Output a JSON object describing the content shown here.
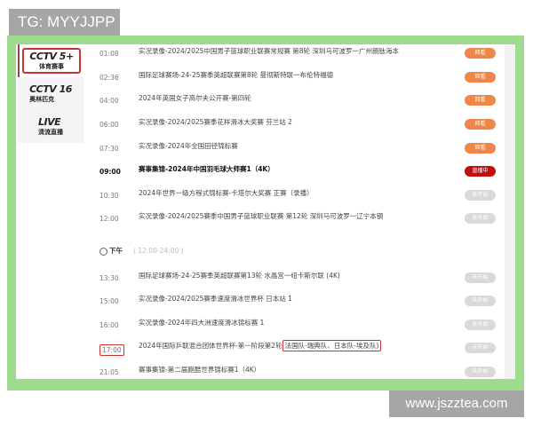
{
  "watermark_top": "TG: MYYJJPP",
  "watermark_bottom": "www.jszztea.com",
  "colors": {
    "frame": "#9fdb8f",
    "replay": "#f0874a",
    "live": "#c40d0d",
    "upcoming": "#d9d9d9",
    "highlight": "#c8342f"
  },
  "channels": [
    {
      "logo": "CCTV 5+",
      "sub": "体育赛事",
      "active": true
    },
    {
      "logo": "CCTV 16",
      "sub": "奥林匹克",
      "active": false
    },
    {
      "logo": "LIVE",
      "sub": "清流直播",
      "active": false
    }
  ],
  "period": {
    "icon": "clock-icon",
    "label": "下午",
    "range": "( 12:00-24:00 )"
  },
  "morning": [
    {
      "time": "01:08",
      "title": "实况录像-2024/2025中国男子篮球职业联赛常规赛 第8轮 深圳马可波罗一广州朗肽海本",
      "status": "回看",
      "type": "replay"
    },
    {
      "time": "02:36",
      "title": "国际足球赛场-24-25赛季英超联赛第8轮 曼彻斯特联一布伦特福德",
      "status": "回看",
      "type": "replay"
    },
    {
      "time": "04:00",
      "title": "2024年英国女子高尔夫公开赛-第四轮",
      "status": "回看",
      "type": "replay"
    },
    {
      "time": "06:00",
      "title": "实况录像-2024/2025赛季花样滑冰大奖赛 芬兰站 2",
      "status": "回看",
      "type": "replay"
    },
    {
      "time": "07:30",
      "title": "实况录像-2024年全国田径锦标赛",
      "status": "回看",
      "type": "replay"
    },
    {
      "time": "09:00",
      "title": "赛事集锦-2024年中国羽毛球大师赛1（4K）",
      "status": "直播中",
      "type": "live"
    },
    {
      "time": "10:30",
      "title": "2024年世界一级方程式锦标赛-卡塔尔大奖赛 正赛（录播）",
      "status": "未开始",
      "type": "upcoming"
    },
    {
      "time": "12:00",
      "title": "实况录像-2024/2025赛季中国男子篮球职业联赛 第12轮 深圳马可波罗一辽宁本钢",
      "status": "未开始",
      "type": "upcoming"
    }
  ],
  "afternoon": [
    {
      "time": "13:30",
      "title": "国际足球赛场-24-25赛季英超联赛第13轮 水晶宫一纽卡斯尔联 (4K)",
      "status": "未开始",
      "type": "upcoming"
    },
    {
      "time": "15:00",
      "title": "实况录像-2024/2025赛季速度滑冰世界杯 日本站 1",
      "status": "未开始",
      "type": "upcoming"
    },
    {
      "time": "16:00",
      "title": "实况录像-2024年四大洲速度滑冰锦标赛 1",
      "status": "未开始",
      "type": "upcoming"
    },
    {
      "time": "17:00",
      "title": "2024年国际乒联混合团体世界杯-第一阶段第2轮",
      "title_highlight": "法国队-瑞典队、日本队-埃及队)",
      "status": "未开始",
      "type": "upcoming"
    },
    {
      "time": "21:05",
      "title": "赛事集锦-第二届跑酷世界锦标赛1（4K）",
      "status": "未开始",
      "type": "upcoming"
    }
  ]
}
